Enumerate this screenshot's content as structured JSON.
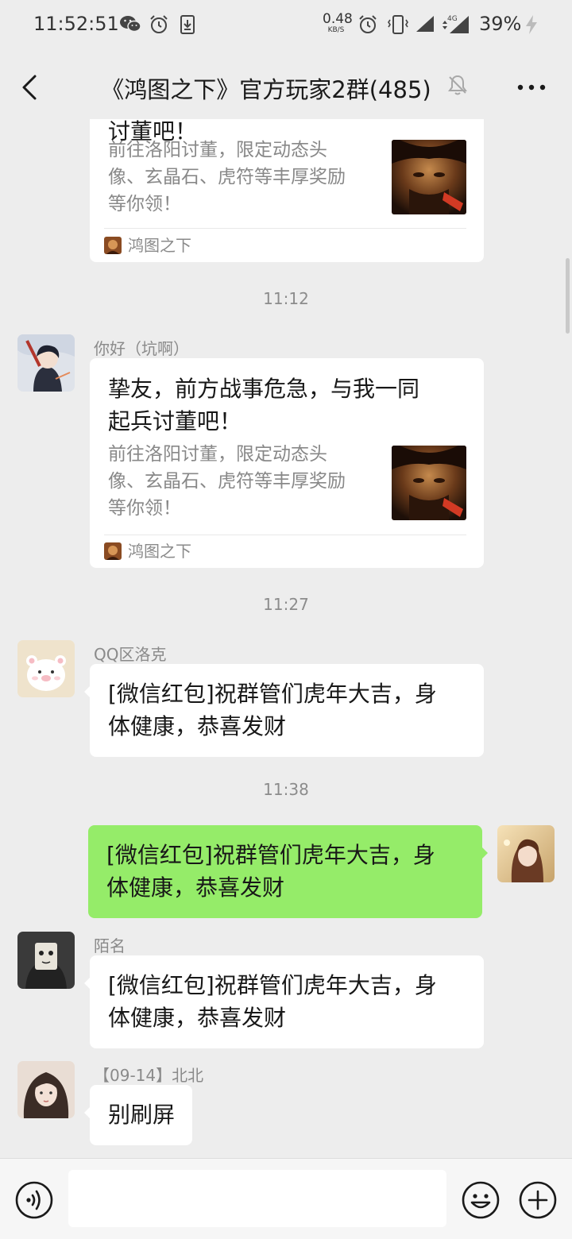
{
  "status_bar": {
    "time": "11:52:51",
    "net_speed_value": "0.48",
    "net_speed_unit": "KB/S",
    "network_type": "4G",
    "battery": "39%",
    "icons": [
      "wechat-icon",
      "alarm-icon",
      "download-icon",
      "alarm-icon",
      "vibrate-icon",
      "signal-icon",
      "signal-4g-icon",
      "charging-icon"
    ]
  },
  "nav": {
    "title": "《鸿图之下》官方玩家2群(485)",
    "icons": [
      "back-arrow-icon",
      "mute-bell-icon",
      "more-dots-icon"
    ]
  },
  "messages": [
    {
      "type": "link-card",
      "title": "挚友，前方战事危急，与我一同起兵讨董吧！",
      "desc_lines": [
        "前往洛阳讨董，限定动态头",
        "像、玄晶石、虎符等丰厚奖励",
        "等你领！"
      ],
      "source": "鸿图之下"
    },
    {
      "type": "time",
      "text": "11:12"
    },
    {
      "type": "link-card",
      "sender": "你好（坑啊）",
      "title_lines": [
        "挚友，前方战事危急，与我一同",
        "起兵讨董吧！"
      ],
      "desc_lines": [
        "前往洛阳讨董，限定动态头",
        "像、玄晶石、虎符等丰厚奖励",
        "等你领！"
      ],
      "source": "鸿图之下"
    },
    {
      "type": "time",
      "text": "11:27"
    },
    {
      "type": "text",
      "sender": "QQ区洛克",
      "lines": [
        "[微信红包]祝群管们虎年大吉，身",
        "体健康，恭喜发财"
      ]
    },
    {
      "type": "time",
      "text": "11:38"
    },
    {
      "type": "text",
      "from_me": true,
      "lines": [
        "[微信红包]祝群管们虎年大吉，身",
        "体健康，恭喜发财"
      ]
    },
    {
      "type": "text",
      "sender": "陌名",
      "lines": [
        "[微信红包]祝群管们虎年大吉，身",
        "体健康，恭喜发财"
      ]
    },
    {
      "type": "text",
      "sender": "【09-14】北北",
      "lines": [
        "别刷屏"
      ]
    }
  ],
  "input_bar": {
    "placeholder": "",
    "icons": [
      "voice-icon",
      "emoji-icon",
      "plus-icon"
    ]
  },
  "colors": {
    "background": "#ededed",
    "bubble_other": "#ffffff",
    "bubble_self": "#95ec69",
    "muted_text": "#8a8a8a"
  }
}
